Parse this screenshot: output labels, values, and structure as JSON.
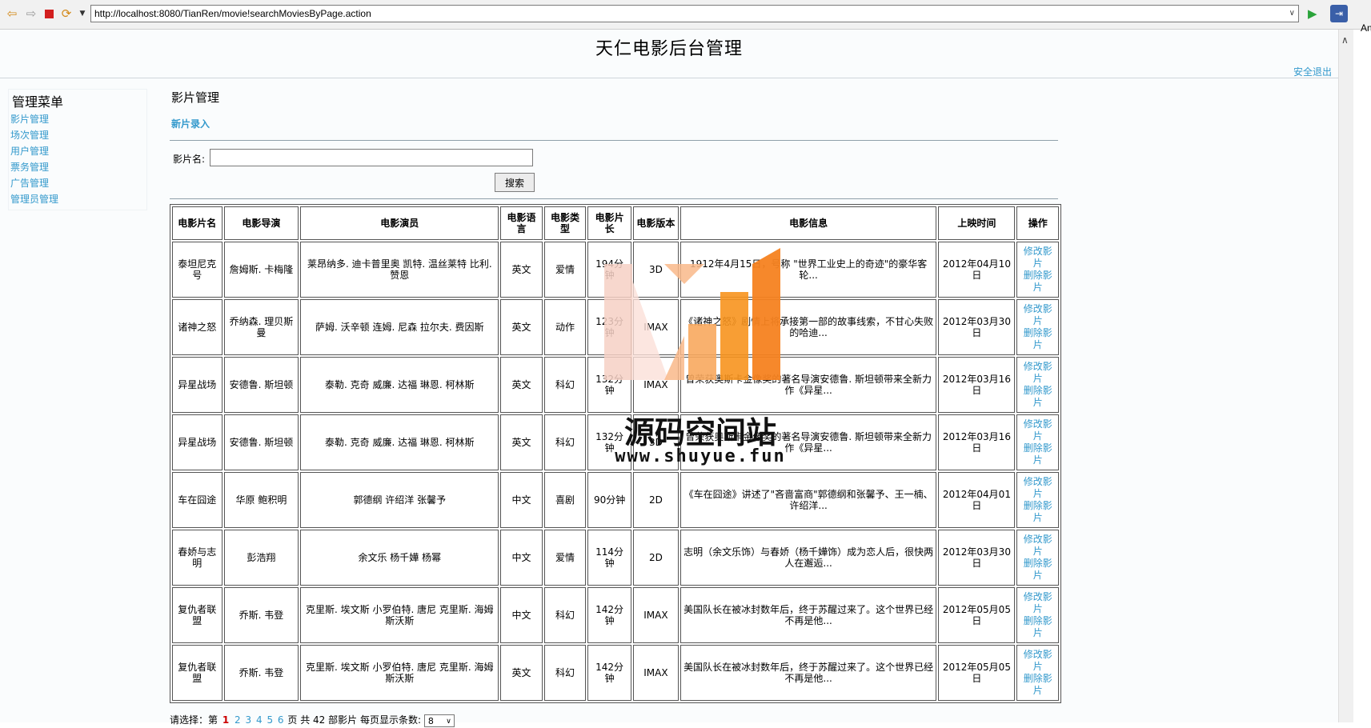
{
  "browser": {
    "url": "http://localhost:8080/TianRen/movie!searchMoviesByPage.action",
    "side_text": "An"
  },
  "header": {
    "title": "天仁电影后台管理",
    "logout": "安全退出"
  },
  "sidebar": {
    "title": "管理菜单",
    "items": [
      {
        "label": "影片管理"
      },
      {
        "label": "场次管理"
      },
      {
        "label": "用户管理"
      },
      {
        "label": "票务管理"
      },
      {
        "label": "广告管理"
      },
      {
        "label": "管理员管理"
      }
    ]
  },
  "main": {
    "section_title": "影片管理",
    "new_link": "新片录入",
    "search": {
      "label": "影片名:",
      "value": "",
      "button": "搜索"
    },
    "table": {
      "headers": [
        "电影片名",
        "电影导演",
        "电影演员",
        "电影语言",
        "电影类型",
        "电影片长",
        "电影版本",
        "电影信息",
        "上映时间",
        "操作"
      ],
      "edit_label": "修改影片",
      "delete_label": "删除影片",
      "rows": [
        {
          "name": "泰坦尼克号",
          "director": "詹姆斯. 卡梅隆",
          "actors": "莱昂纳多. 迪卡普里奥 凯特. 温丝莱特 比利. 赞恩",
          "language": "英文",
          "genre": "爱情",
          "length": "194分钟",
          "version": "3D",
          "info": "1912年4月15日，号称 \"世界工业史上的奇迹\"的豪华客轮...",
          "date": "2012年04月10日"
        },
        {
          "name": "诸神之怒",
          "director": "乔纳森. 理贝斯曼",
          "actors": "萨姆. 沃辛顿 连姆. 尼森 拉尔夫. 费因斯",
          "language": "英文",
          "genre": "动作",
          "length": "123分钟",
          "version": "IMAX",
          "info": "《诸神之怒》剧情上将承接第一部的故事线索，不甘心失败的哈迪...",
          "date": "2012年03月30日"
        },
        {
          "name": "异星战场",
          "director": "安德鲁. 斯坦顿",
          "actors": "泰勒. 克奇 威廉. 达福 琳恩. 柯林斯",
          "language": "英文",
          "genre": "科幻",
          "length": "132分钟",
          "version": "IMAX",
          "info": "曾荣获奥斯卡金像奖的著名导演安德鲁. 斯坦顿带来全新力作《异星...",
          "date": "2012年03月16日"
        },
        {
          "name": "异星战场",
          "director": "安德鲁. 斯坦顿",
          "actors": "泰勒. 克奇 威廉. 达福 琳恩. 柯林斯",
          "language": "英文",
          "genre": "科幻",
          "length": "132分钟",
          "version": "3D",
          "info": "曾荣获奥斯卡金像奖的著名导演安德鲁. 斯坦顿带来全新力作《异星...",
          "date": "2012年03月16日"
        },
        {
          "name": "车在囧途",
          "director": "华原 鲍积明",
          "actors": "郭德纲 许绍洋 张馨予",
          "language": "中文",
          "genre": "喜剧",
          "length": "90分钟",
          "version": "2D",
          "info": "《车在囧途》讲述了\"吝啬富商\"郭德纲和张馨予、王一楠、许绍洋...",
          "date": "2012年04月01日"
        },
        {
          "name": "春娇与志明",
          "director": "彭浩翔",
          "actors": "余文乐 杨千嬅 杨幂",
          "language": "中文",
          "genre": "爱情",
          "length": "114分钟",
          "version": "2D",
          "info": "志明（余文乐饰）与春娇（杨千嬅饰）成为恋人后，很快两人在邂逅...",
          "date": "2012年03月30日"
        },
        {
          "name": "复仇者联盟",
          "director": "乔斯. 韦登",
          "actors": "克里斯. 埃文斯 小罗伯特. 唐尼 克里斯. 海姆斯沃斯",
          "language": "中文",
          "genre": "科幻",
          "length": "142分钟",
          "version": "IMAX",
          "info": "美国队长在被冰封数年后，终于苏醒过来了。这个世界已经不再是他...",
          "date": "2012年05月05日"
        },
        {
          "name": "复仇者联盟",
          "director": "乔斯. 韦登",
          "actors": "克里斯. 埃文斯 小罗伯特. 唐尼 克里斯. 海姆斯沃斯",
          "language": "英文",
          "genre": "科幻",
          "length": "142分钟",
          "version": "IMAX",
          "info": "美国队长在被冰封数年后，终于苏醒过来了。这个世界已经不再是他...",
          "date": "2012年05月05日"
        }
      ]
    },
    "pager": {
      "prefix": "请选择：第",
      "pages": [
        "1",
        "2",
        "3",
        "4",
        "5",
        "6"
      ],
      "current": "1",
      "suffix_page": "页",
      "total_text": "共 42 部影片",
      "per_page_label": "每页显示条数:",
      "per_page_value": "8"
    }
  },
  "watermark": {
    "text": "源码空间站",
    "url": "www.shuyue.fun"
  },
  "colors": {
    "link": "#3399cc",
    "current_page": "#cc0000",
    "watermark_orange": "#f7931e",
    "watermark_light": "#f6d0c4"
  }
}
